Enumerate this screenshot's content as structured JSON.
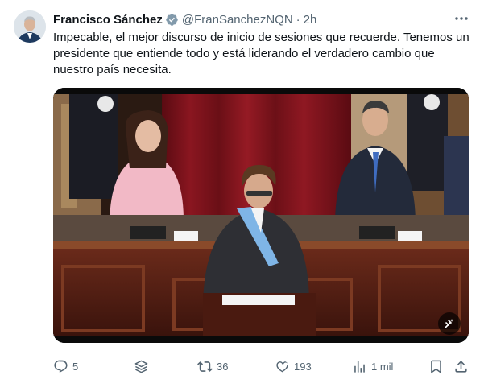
{
  "author": {
    "name": "Francisco Sánchez",
    "handle": "@FranSanchezNQN",
    "separator": "·",
    "time": "2h"
  },
  "tweet": {
    "text": "Impecable, el mejor discurso de inicio de sesiones que recuerde. Tenemos un presidente que entiende todo y está liderando el verdadero cambio que nuestro país necesita."
  },
  "actions": {
    "replies": "5",
    "retweets": "36",
    "likes": "193",
    "views": "1 mil"
  },
  "colors": {
    "verified": "#829aab",
    "muted": "#536471",
    "text": "#0f1419"
  }
}
